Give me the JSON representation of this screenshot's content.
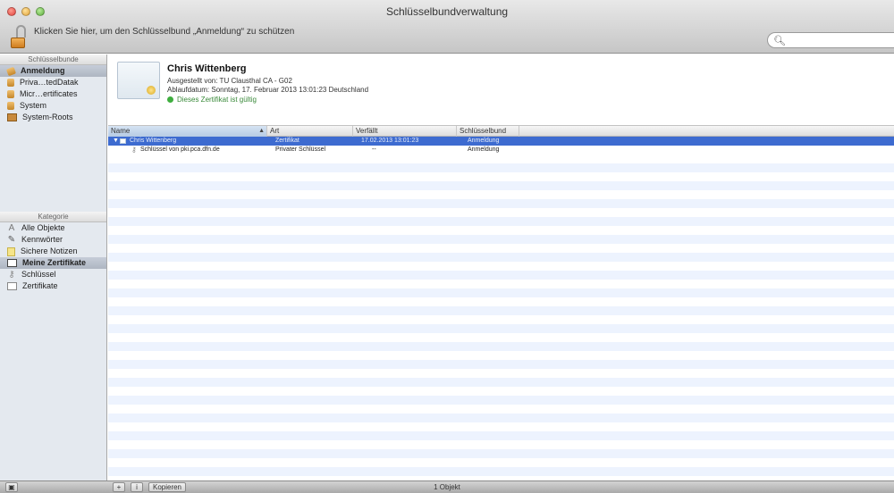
{
  "window": {
    "title": "Schlüsselbundverwaltung",
    "lock_hint": "Klicken Sie hier, um den Schlüsselbund „Anmeldung“ zu schützen",
    "search_placeholder": ""
  },
  "sidebar": {
    "keychains_header": "Schlüsselbunde",
    "keychains": [
      {
        "label": "Anmeldung",
        "icon": "lock-open-icon",
        "selected": true
      },
      {
        "label": "Priva…tedDatak",
        "icon": "lock-icon",
        "selected": false
      },
      {
        "label": "Micr…ertificates",
        "icon": "lock-icon",
        "selected": false
      },
      {
        "label": "System",
        "icon": "lock-icon",
        "selected": false
      },
      {
        "label": "System-Roots",
        "icon": "cabinet-icon",
        "selected": false
      }
    ],
    "category_header": "Kategorie",
    "categories": [
      {
        "label": "Alle Objekte",
        "icon": "all-items-icon",
        "selected": false
      },
      {
        "label": "Kennwörter",
        "icon": "password-icon",
        "selected": false
      },
      {
        "label": "Sichere Notizen",
        "icon": "note-icon",
        "selected": false
      },
      {
        "label": "Meine Zertifikate",
        "icon": "my-certificate-icon",
        "selected": true
      },
      {
        "label": "Schlüssel",
        "icon": "key-icon",
        "selected": false
      },
      {
        "label": "Zertifikate",
        "icon": "certificate-icon",
        "selected": false
      }
    ]
  },
  "detail": {
    "name": "Chris Wittenberg",
    "issuer": "Ausgestellt von: TU Clausthal CA - G02",
    "expiry": "Ablaufdatum: Sonntag, 17. Februar 2013 13:01:23 Deutschland",
    "validity": "Dieses Zertifikat ist gültig"
  },
  "table": {
    "columns": [
      "Name",
      "Art",
      "Verfällt",
      "Schlüsselbund"
    ],
    "rows": [
      {
        "name": "Chris Wittenberg",
        "kind": "Zertifikat",
        "expires": "17.02.2013 13:01:23",
        "keychain": "Anmeldung",
        "selected": true
      },
      {
        "name": "Schlüssel von pki.pca.dfn.de",
        "kind": "Privater Schlüssel",
        "expires": "--",
        "keychain": "Anmeldung",
        "selected": false
      }
    ]
  },
  "bottombar": {
    "add_label": "+",
    "info_label": "i",
    "copy_label": "Kopieren",
    "status": "1 Objekt"
  },
  "colors": {
    "selection": "#3d6bd0",
    "stripe": "#edf3fe",
    "sidebar_bg": "#e4e9ef",
    "valid_green": "#3fae3f"
  }
}
